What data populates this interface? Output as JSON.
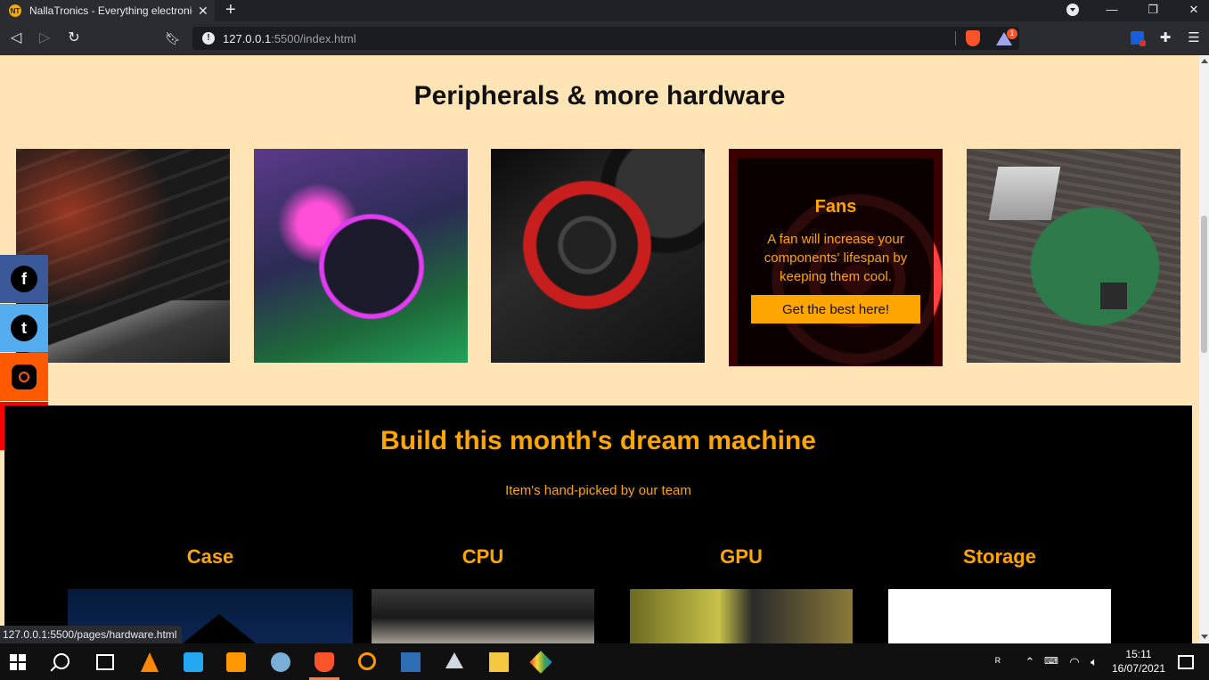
{
  "browser": {
    "tab_title": "NallaTronics - Everything electronics",
    "tab_favicon": "NT",
    "tab_close": "✕",
    "new_tab": "+",
    "url_host": "127.0.0.1",
    "url_path": ":5500/index.html",
    "reward_badge": "1",
    "window_controls": {
      "minimize": "—",
      "maximize": "❐",
      "close": "✕"
    }
  },
  "peripherals": {
    "title": "Peripherals & more hardware",
    "fan_card": {
      "title": "Fans",
      "text": "A fan will increase your components' lifespan by keeping them cool.",
      "button": "Get the best here!"
    }
  },
  "social": {
    "facebook": "f",
    "twitter": "t"
  },
  "dream": {
    "title": "Build this month's dream machine",
    "subtitle": "Item's hand-picked by our team",
    "parts": [
      "Case",
      "CPU",
      "GPU",
      "Storage"
    ]
  },
  "status_url": "127.0.0.1:5500/pages/hardware.html",
  "taskbar": {
    "time": "15:11",
    "date": "16/07/2021"
  },
  "colors": {
    "page_bg": "#ffe4b5",
    "accent": "#ffa500",
    "facebook": "#3b5998",
    "twitter": "#55acee",
    "instagram": "#ff5a00",
    "youtube": "#ff0000"
  }
}
